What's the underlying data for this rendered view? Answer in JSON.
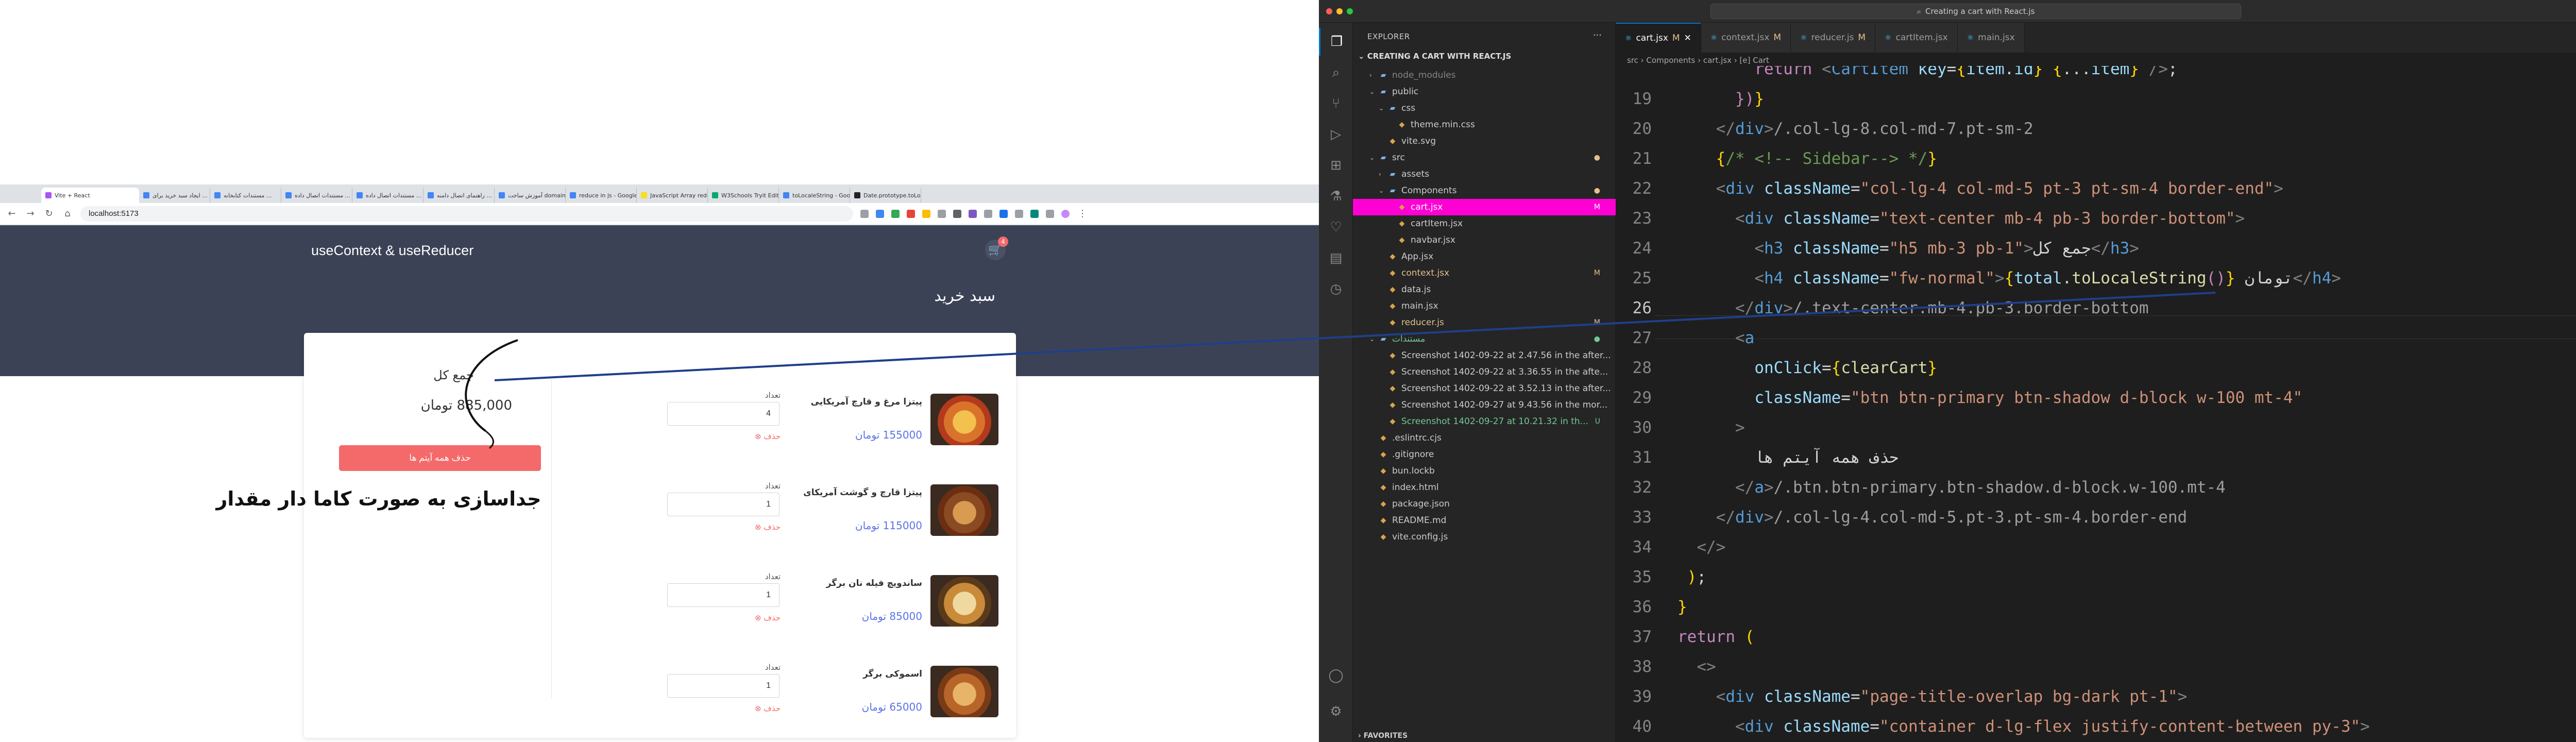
{
  "browser": {
    "tabs": [
      {
        "label": "Vite + React",
        "color": "#a855f7"
      },
      {
        "label": "ایجاد سبد خرید برای ...",
        "color": "#4285f4"
      },
      {
        "label": "مستندات کتابخانه ...",
        "color": "#4285f4"
      },
      {
        "label": "مستندات اتصال داده ...",
        "color": "#4285f4"
      },
      {
        "label": "مستندات اتصال داده ...",
        "color": "#4285f4"
      },
      {
        "label": "راهنمای اتصال دامنه ...",
        "color": "#4285f4"
      },
      {
        "label": "آموزش ساخت domain ...",
        "color": "#4285f4"
      },
      {
        "label": "reduce in js - Google",
        "color": "#4285f4"
      },
      {
        "label": "JavaScript Array redu...",
        "color": "#f7df1e"
      },
      {
        "label": "W3Schools Tryit Edit...",
        "color": "#04aa6d"
      },
      {
        "label": "toLocaleString - Goog...",
        "color": "#4285f4"
      },
      {
        "label": "Date.prototype.toLoc...",
        "color": "#222222"
      }
    ],
    "url": "localhost:5173",
    "site": {
      "brand": "useContext & useReducer",
      "cart_badge": "4",
      "page_title": "سبد خرید",
      "summary_title": "جمع کل",
      "total": "885,000 تومان",
      "clear_button": "حذف همه آیتم ها",
      "items": [
        {
          "name": "پیتزا مرغ و قارچ آمریکایی",
          "price": "155000 تومان",
          "qty_label": "تعداد",
          "qty": "4",
          "delete": "حذف"
        },
        {
          "name": "پیتزا قارچ و گوشت آمریکای",
          "price": "115000 تومان",
          "qty_label": "تعداد",
          "qty": "1",
          "delete": "حذف"
        },
        {
          "name": "ساندویچ فیله نان برگر",
          "price": "85000 تومان",
          "qty_label": "تعداد",
          "qty": "1",
          "delete": "حذف"
        },
        {
          "name": "اسموکی برگر",
          "price": "65000 تومان",
          "qty_label": "تعداد",
          "qty": "1",
          "delete": "حذف"
        }
      ]
    },
    "annotation_text": "جداسازی به صورت کاما دار مقدار"
  },
  "vscode": {
    "title": "Creating a cart with React.js",
    "sidebar": {
      "header": "EXPLORER",
      "project": "CREATING A CART WITH REACT.JS",
      "favorites": "FAVORITES",
      "rows": [
        {
          "label": "node_modules",
          "kind": "folder",
          "depth": 1,
          "color": "#858585"
        },
        {
          "label": "public",
          "kind": "folder-open",
          "depth": 1,
          "color": "#cccccc"
        },
        {
          "label": "css",
          "kind": "folder-open",
          "depth": 2,
          "color": "#cccccc"
        },
        {
          "label": "theme.min.css",
          "kind": "file",
          "depth": 3,
          "color": "#cccccc"
        },
        {
          "label": "vite.svg",
          "kind": "file",
          "depth": 2,
          "color": "#cccccc"
        },
        {
          "label": "src",
          "kind": "folder-open",
          "depth": 1,
          "color": "#cccccc",
          "status": "●",
          "status_color": "#e2c08d"
        },
        {
          "label": "assets",
          "kind": "folder",
          "depth": 2,
          "color": "#cccccc"
        },
        {
          "label": "Components",
          "kind": "folder-open",
          "depth": 2,
          "color": "#cccccc",
          "status": "●",
          "status_color": "#e2c08d"
        },
        {
          "label": "cart.jsx",
          "kind": "file",
          "depth": 3,
          "color": "#ffffff",
          "status": "M",
          "status_color": "#ffffff",
          "selected": true
        },
        {
          "label": "cartItem.jsx",
          "kind": "file",
          "depth": 3,
          "color": "#cccccc"
        },
        {
          "label": "navbar.jsx",
          "kind": "file",
          "depth": 3,
          "color": "#cccccc"
        },
        {
          "label": "App.jsx",
          "kind": "file",
          "depth": 2,
          "color": "#cccccc"
        },
        {
          "label": "context.jsx",
          "kind": "file",
          "depth": 2,
          "color": "#e2c08d",
          "status": "M",
          "status_color": "#e2c08d"
        },
        {
          "label": "data.js",
          "kind": "file",
          "depth": 2,
          "color": "#cccccc"
        },
        {
          "label": "main.jsx",
          "kind": "file",
          "depth": 2,
          "color": "#cccccc"
        },
        {
          "label": "reducer.js",
          "kind": "file",
          "depth": 2,
          "color": "#e2c08d",
          "status": "M",
          "status_color": "#e2c08d"
        },
        {
          "label": "مستندات",
          "kind": "folder-open",
          "depth": 1,
          "color": "#73c991",
          "status": "●",
          "status_color": "#73c991"
        },
        {
          "label": "Screenshot 1402-09-22 at 2.47.56 in the after...",
          "kind": "file",
          "depth": 2,
          "color": "#cccccc"
        },
        {
          "label": "Screenshot 1402-09-22 at 3.36.55 in the afte...",
          "kind": "file",
          "depth": 2,
          "color": "#cccccc"
        },
        {
          "label": "Screenshot 1402-09-22 at 3.52.13 in the after...",
          "kind": "file",
          "depth": 2,
          "color": "#cccccc"
        },
        {
          "label": "Screenshot 1402-09-27 at 9.43.56 in the mor...",
          "kind": "file",
          "depth": 2,
          "color": "#cccccc"
        },
        {
          "label": "Screenshot 1402-09-27 at 10.21.32 in th...",
          "kind": "file",
          "depth": 2,
          "color": "#73c991",
          "status": "U",
          "status_color": "#73c991"
        },
        {
          "label": ".eslintrc.cjs",
          "kind": "file",
          "depth": 1,
          "color": "#cccccc"
        },
        {
          "label": ".gitignore",
          "kind": "file",
          "depth": 1,
          "color": "#cccccc"
        },
        {
          "label": "bun.lockb",
          "kind": "file",
          "depth": 1,
          "color": "#cccccc"
        },
        {
          "label": "index.html",
          "kind": "file",
          "depth": 1,
          "color": "#cccccc"
        },
        {
          "label": "package.json",
          "kind": "file",
          "depth": 1,
          "color": "#cccccc"
        },
        {
          "label": "README.md",
          "kind": "file",
          "depth": 1,
          "color": "#cccccc"
        },
        {
          "label": "vite.config.js",
          "kind": "file",
          "depth": 1,
          "color": "#cccccc"
        }
      ]
    },
    "tabs": [
      {
        "label": "cart.jsx",
        "status": "M",
        "active": true
      },
      {
        "label": "context.jsx",
        "status": "M"
      },
      {
        "label": "reducer.js",
        "status": "M"
      },
      {
        "label": "cartItem.jsx",
        "status": ""
      },
      {
        "label": "main.jsx",
        "status": ""
      }
    ],
    "breadcrumb": "src  ›  Components  ›  cart.jsx  ›  [e] Cart",
    "code": [
      {
        "n": "",
        "html": "        <span class=\"k\">return</span> <span class=\"p\">&lt;</span><span class=\"t\">CartItem</span> <span class=\"a\">key</span>=<span class=\"b\">{</span><span class=\"a\">item</span>.<span class=\"a\">id</span><span class=\"b\">}</span> <span class=\"b\">{</span>...<span class=\"a\">item</span><span class=\"b\">}</span> <span class=\"p\">/&gt;</span>;"
      },
      {
        "n": "19",
        "html": "      <span class=\"k\">})</span><span class=\"b\">}</span>"
      },
      {
        "n": "20",
        "html": "    <span class=\"p\">&lt;/</span><span class=\"t\">div</span><span class=\"p\">&gt;</span><span class=\"g\">/.col-lg-8.col-md-7.pt-sm-2</span>"
      },
      {
        "n": "21",
        "html": "    <span class=\"b\">{</span><span class=\"c\">/* &lt;!-- Sidebar--&gt; */</span><span class=\"b\">}</span>"
      },
      {
        "n": "22",
        "html": "    <span class=\"p\">&lt;</span><span class=\"t\">div</span> <span class=\"a\">className</span>=<span class=\"s\">\"col-lg-4 col-md-5 pt-3 pt-sm-4 border-end\"</span><span class=\"p\">&gt;</span>"
      },
      {
        "n": "23",
        "html": "      <span class=\"p\">&lt;</span><span class=\"t\">div</span> <span class=\"a\">className</span>=<span class=\"s\">\"text-center mb-4 pb-3 border-bottom\"</span><span class=\"p\">&gt;</span>"
      },
      {
        "n": "24",
        "html": "        <span class=\"p\">&lt;</span><span class=\"t\">h3</span> <span class=\"a\">className</span>=<span class=\"s\">\"h5 mb-3 pb-1\"</span><span class=\"p\">&gt;</span>جمع کل<span class=\"p\">&lt;/</span><span class=\"t\">h3</span><span class=\"p\">&gt;</span>"
      },
      {
        "n": "25",
        "html": "        <span class=\"p\">&lt;</span><span class=\"t\">h4</span> <span class=\"a\">className</span>=<span class=\"s\">\"fw-normal\"</span><span class=\"p\">&gt;</span><span class=\"b\">{</span><span class=\"a\">total</span>.<span class=\"f\">toLocaleString</span><span class=\"k\">()</span><span class=\"b\">}</span> تومان<span class=\"p\">&lt;/</span><span class=\"t\">h4</span><span class=\"p\">&gt;</span>"
      },
      {
        "n": "26",
        "html": "      <span class=\"p\">&lt;/</span><span class=\"t\">div</span><span class=\"p\">&gt;</span><span class=\"g\">/.text-center.mb-4.pb-3.border-bottom</span>"
      },
      {
        "n": "27",
        "html": "      <span class=\"p\">&lt;</span><span class=\"t\">a</span>"
      },
      {
        "n": "28",
        "html": "        <span class=\"a\">onClick</span>=<span class=\"b\">{</span><span class=\"f\">clearCart</span><span class=\"b\">}</span>"
      },
      {
        "n": "29",
        "html": "        <span class=\"a\">className</span>=<span class=\"s\">\"btn btn-primary btn-shadow d-block w-100 mt-4\"</span>"
      },
      {
        "n": "30",
        "html": "      <span class=\"p\">&gt;</span>"
      },
      {
        "n": "31",
        "html": "        حذف همه آیتم ها"
      },
      {
        "n": "32",
        "html": "      <span class=\"p\">&lt;/</span><span class=\"t\">a</span><span class=\"p\">&gt;</span><span class=\"g\">/.btn.btn-primary.btn-shadow.d-block.w-100.mt-4</span>"
      },
      {
        "n": "33",
        "html": "    <span class=\"p\">&lt;/</span><span class=\"t\">div</span><span class=\"p\">&gt;</span><span class=\"g\">/.col-lg-4.col-md-5.pt-3.pt-sm-4.border-end</span>"
      },
      {
        "n": "34",
        "html": "  <span class=\"p\">&lt;/&gt;</span>"
      },
      {
        "n": "35",
        "html": " <span class=\"b\">)</span>;"
      },
      {
        "n": "36",
        "html": "<span class=\"b\">}</span>"
      },
      {
        "n": "37",
        "html": "<span class=\"k\">return</span> <span class=\"b\">(</span>"
      },
      {
        "n": "38",
        "html": "  <span class=\"p\">&lt;&gt;</span>"
      },
      {
        "n": "39",
        "html": "    <span class=\"p\">&lt;</span><span class=\"t\">div</span> <span class=\"a\">className</span>=<span class=\"s\">\"page-title-overlap bg-dark pt-1\"</span><span class=\"p\">&gt;</span>"
      },
      {
        "n": "40",
        "html": "      <span class=\"p\">&lt;</span><span class=\"t\">div</span> <span class=\"a\">className</span>=<span class=\"s\">\"container d-lg-flex justify-content-between py-3\"</span><span class=\"p\">&gt;</span>"
      }
    ],
    "current_line": "26"
  }
}
